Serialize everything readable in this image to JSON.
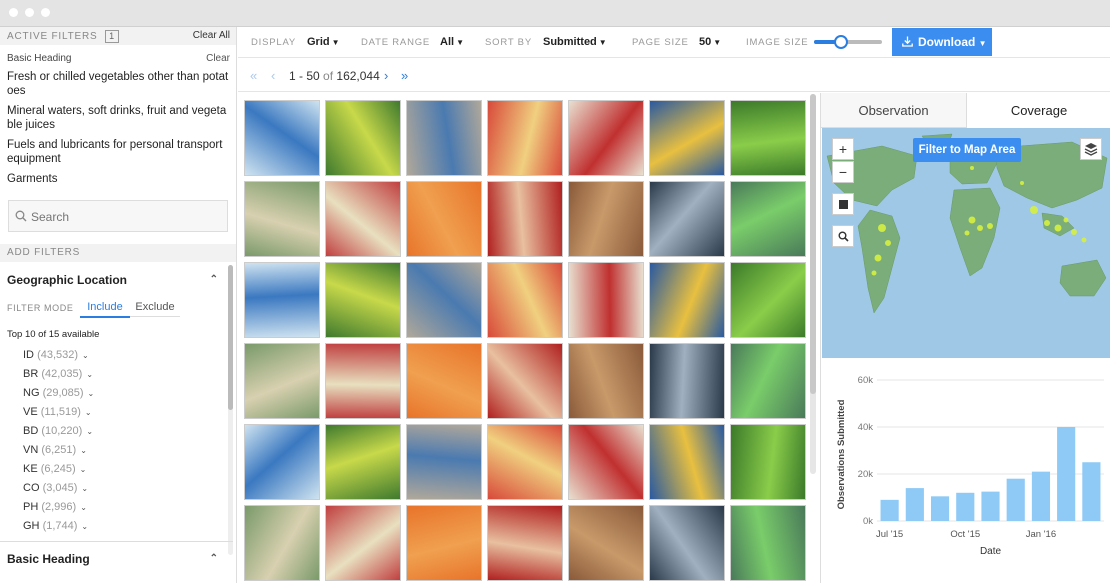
{
  "active_filters": {
    "title": "ACTIVE FILTERS",
    "count": "1",
    "clear_all": "Clear All",
    "group_title": "Basic Heading",
    "group_clear": "Clear",
    "items": [
      "Fresh or chilled vegetables other than potatoes",
      "Mineral waters, soft drinks, fruit and vegetable juices",
      "Fuels and lubricants for personal transport equipment",
      "Garments"
    ]
  },
  "search": {
    "placeholder": "Search"
  },
  "add_filters": {
    "title": "ADD FILTERS",
    "geo_title": "Geographic Location",
    "filter_mode_label": "FILTER MODE",
    "include_label": "Include",
    "exclude_label": "Exclude",
    "top_label": "Top 10 of 15 available",
    "countries": [
      {
        "code": "ID",
        "count": "(43,532)"
      },
      {
        "code": "BR",
        "count": "(42,035)"
      },
      {
        "code": "NG",
        "count": "(29,085)"
      },
      {
        "code": "VE",
        "count": "(11,519)"
      },
      {
        "code": "BD",
        "count": "(10,220)"
      },
      {
        "code": "VN",
        "count": "(6,251)"
      },
      {
        "code": "KE",
        "count": "(6,245)"
      },
      {
        "code": "CO",
        "count": "(3,045)"
      },
      {
        "code": "PH",
        "count": "(2,996)"
      },
      {
        "code": "GH",
        "count": "(1,744)"
      }
    ],
    "basic_heading_title": "Basic Heading"
  },
  "toolbar": {
    "display_label": "DISPLAY",
    "display_value": "Grid",
    "date_range_label": "DATE RANGE",
    "date_range_value": "All",
    "sort_by_label": "SORT BY",
    "sort_by_value": "Submitted",
    "page_size_label": "PAGE SIZE",
    "page_size_value": "50",
    "image_size_label": "IMAGE SIZE",
    "image_size_level": 0.4,
    "download_label": "Download"
  },
  "pagination": {
    "range": "1 - 50",
    "of": "of",
    "total": "162,044"
  },
  "grid_images": [
    "bottled-water",
    "cucumbers",
    "shop-front",
    "juice-boxes",
    "juice-shelf",
    "bottle-display",
    "cucumbers-crate",
    "building",
    "cafe-sign",
    "carrots",
    "coca-cola-bottles",
    "onions",
    "fuel-pumps",
    "cucumbers-pile",
    "fuel-pump-screen",
    "fuel-dispenser",
    "soft-drink-cans",
    "water-bottles",
    "water-shelf",
    "water-packs",
    "garment",
    "juice-cartons",
    "jeans-rack",
    "jeans",
    "jeans-hanging",
    "jacket",
    "bag",
    "cucumbers-market",
    "black-shirt",
    "coca-cola-can",
    "carrots-crate",
    "street",
    "top-up-sign",
    "onions-crate",
    "tomatoes",
    "potatoes",
    "onions-pile",
    "cucumbers-bags",
    "beans",
    "pepsi-bottle",
    "pepsi-cans",
    "water-bottles-shelf"
  ],
  "right_panel": {
    "tab_observation": "Observation",
    "tab_coverage": "Coverage",
    "map_filter_label": "Filter to Map Area",
    "map_zoom_in": "+",
    "map_zoom_out": "−"
  },
  "colors": {
    "accent": "#3b8ef0",
    "bar": "#8ecaf5"
  },
  "chart_data": {
    "type": "bar",
    "xlabel": "Date",
    "ylabel": "Observations Submitted",
    "ylim": [
      0,
      60000
    ],
    "yticks": [
      "0k",
      "20k",
      "40k",
      "60k"
    ],
    "xtick_labels": [
      "Jul '15",
      "Oct '15",
      "Jan '16"
    ],
    "xtick_index": [
      0,
      3,
      6
    ],
    "values": [
      9000,
      14000,
      10500,
      12000,
      12500,
      18000,
      21000,
      40000,
      25000
    ]
  }
}
